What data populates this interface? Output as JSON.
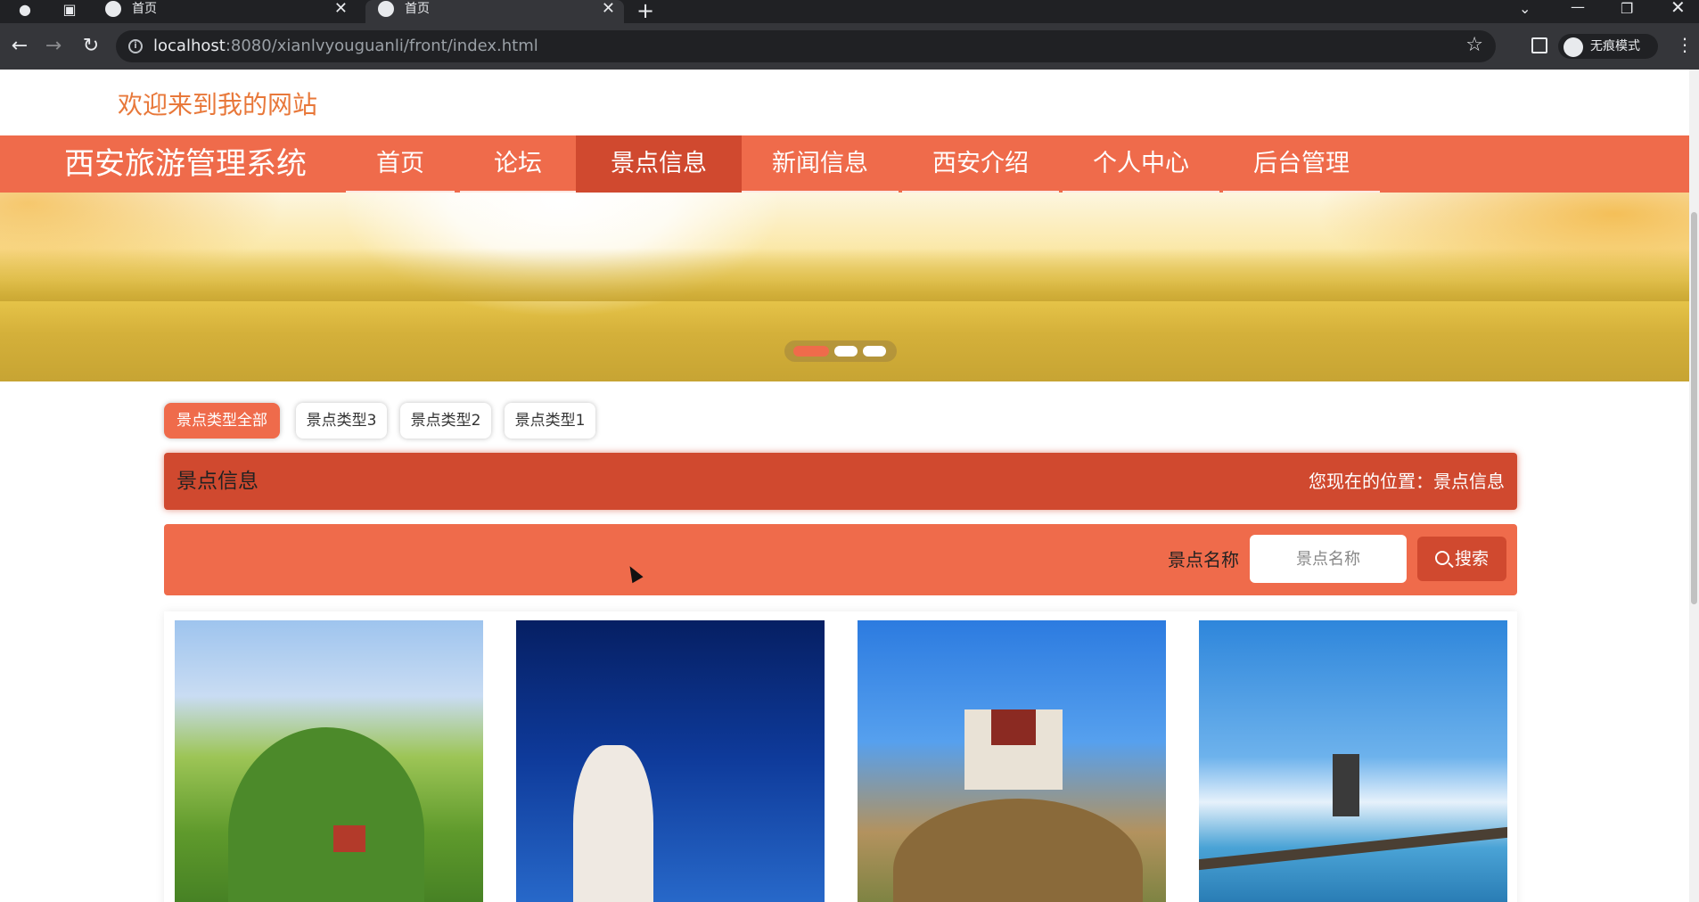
{
  "browser": {
    "tabs": [
      {
        "title": "首页",
        "active": false
      },
      {
        "title": "首页",
        "active": true
      }
    ],
    "url_host": "localhost",
    "url_rest": ":8080/xianlvyouguanli/front/index.html",
    "profile_label": "无痕模式"
  },
  "page": {
    "welcome": "欢迎来到我的网站",
    "site_title": "西安旅游管理系统",
    "nav": [
      {
        "label": "首页",
        "active": false
      },
      {
        "label": "论坛",
        "active": false
      },
      {
        "label": "景点信息",
        "active": true
      },
      {
        "label": "新闻信息",
        "active": false
      },
      {
        "label": "西安介绍",
        "active": false
      },
      {
        "label": "个人中心",
        "active": false
      },
      {
        "label": "后台管理",
        "active": false
      }
    ],
    "carousel": {
      "slide_count": 3,
      "active_slide": 1
    },
    "type_filters": [
      {
        "label": "景点类型全部",
        "active": true
      },
      {
        "label": "景点类型3",
        "active": false
      },
      {
        "label": "景点类型2",
        "active": false
      },
      {
        "label": "景点类型1",
        "active": false
      }
    ],
    "section_title": "景点信息",
    "location": "您现在的位置：景点信息",
    "search": {
      "label": "景点名称",
      "placeholder": "景点名称",
      "button": "搜索"
    }
  },
  "colors": {
    "primary": "#ef6b4b",
    "primary_dark": "#d0492f",
    "welcome_text": "#e8783a"
  }
}
